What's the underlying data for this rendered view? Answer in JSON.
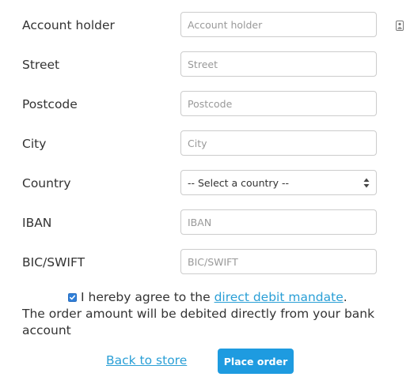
{
  "form": {
    "fields": [
      {
        "label": "Account holder",
        "placeholder": "Account holder",
        "value": ""
      },
      {
        "label": "Street",
        "placeholder": "Street",
        "value": ""
      },
      {
        "label": "Postcode",
        "placeholder": "Postcode",
        "value": ""
      },
      {
        "label": "City",
        "placeholder": "City",
        "value": ""
      },
      {
        "label": "Country",
        "selected": "-- Select a country --"
      },
      {
        "label": "IBAN",
        "placeholder": "IBAN",
        "value": ""
      },
      {
        "label": "BIC/SWIFT",
        "placeholder": "BIC/SWIFT",
        "value": ""
      }
    ],
    "contact_icon": "contact-card-icon",
    "select_icon": "select-arrows-icon"
  },
  "agreement": {
    "checked": true,
    "prefix": "I hereby agree to the ",
    "link_text": "direct debit mandate",
    "suffix": ".",
    "note": "The order amount will be debited directly from your bank account"
  },
  "actions": {
    "back_label": "Back to store",
    "place_order_label": "Place order"
  },
  "colors": {
    "link": "#2a9fd6",
    "button": "#1e9be0",
    "checkbox": "#2f7fd9"
  }
}
